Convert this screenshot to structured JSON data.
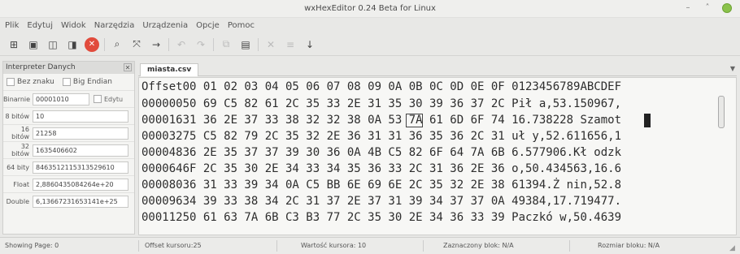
{
  "window": {
    "title": "wxHexEditor 0.24 Beta for Linux"
  },
  "menu": [
    "Plik",
    "Edytuj",
    "Widok",
    "Narzędzia",
    "Urządzenia",
    "Opcje",
    "Pomoc"
  ],
  "interpreter": {
    "title": "Interpreter Danych",
    "no_sign_label": "Bez znaku",
    "big_endian_label": "Big Endian",
    "edit_label": "Edytu",
    "rows": [
      {
        "label": "Binarnie",
        "value": "00001010"
      },
      {
        "label": "8 bitów",
        "value": "10"
      },
      {
        "label": "16 bitów",
        "value": "21258"
      },
      {
        "label": "32 bitów",
        "value": "1635406602"
      },
      {
        "label": "64 bity",
        "value": "8463512115313529610"
      },
      {
        "label": "Float",
        "value": "2,8860435084264e+20"
      },
      {
        "label": "Double",
        "value": "6,13667231653141e+25"
      }
    ]
  },
  "tab": {
    "name": "miasta.csv"
  },
  "hex": {
    "header": "Offset00 01 02 03 04 05 06 07 08 09 0A 0B 0C 0D 0E 0F 0123456789ABCDEF",
    "lines": [
      "00000050 69 C5 82 61 2C 35 33 2E 31 35 30 39 36 37 2C Pił a,53.150967,",
      "00001631 36 2E 37 33 38 32 32 38 0A 53 7A 61 6D 6F 74 16.738228 Szamot",
      "00003275 C5 82 79 2C 35 32 2E 36 31 31 36 35 36 2C 31 uł y,52.611656,1",
      "00004836 2E 35 37 37 39 30 36 0A 4B C5 82 6F 64 7A 6B 6.577906.Kł odzk",
      "0000646F 2C 35 30 2E 34 33 34 35 36 33 2C 31 36 2E 36 o,50.434563,16.6",
      "00008036 31 33 39 34 0A C5 BB 6E 69 6E 2C 35 32 2E 38 61394.Ż nin,52.8",
      "00009634 39 33 38 34 2C 31 37 2E 37 31 39 34 37 37 0A 49384,17.719477.",
      "00011250 61 63 7A 6B C3 B3 77 2C 35 30 2E 34 36 33 39 Paczkó w,50.4639"
    ]
  },
  "status": {
    "page": "Showing Page: 0",
    "offset": "Offset kursoru:25",
    "value": "Wartość kursora: 10",
    "block": "Zaznaczony blok: N/A",
    "size": "Rozmiar bloku: N/A"
  },
  "icons": {
    "new": "new-file-icon",
    "open": "open-file-icon",
    "save": "save-icon",
    "saveas": "save-as-icon",
    "close": "close-file-icon",
    "find": "search-icon",
    "replace": "replace-icon",
    "goto": "goto-offset-icon",
    "undo": "undo-icon",
    "redo": "redo-icon",
    "copy": "copy-icon",
    "paste": "paste-icon",
    "cut": "cut-icon",
    "delete": "delete-icon",
    "insert": "insert-icon"
  },
  "colors": {
    "close_button": "#e14b3c",
    "window_close": "#8ac24a"
  }
}
